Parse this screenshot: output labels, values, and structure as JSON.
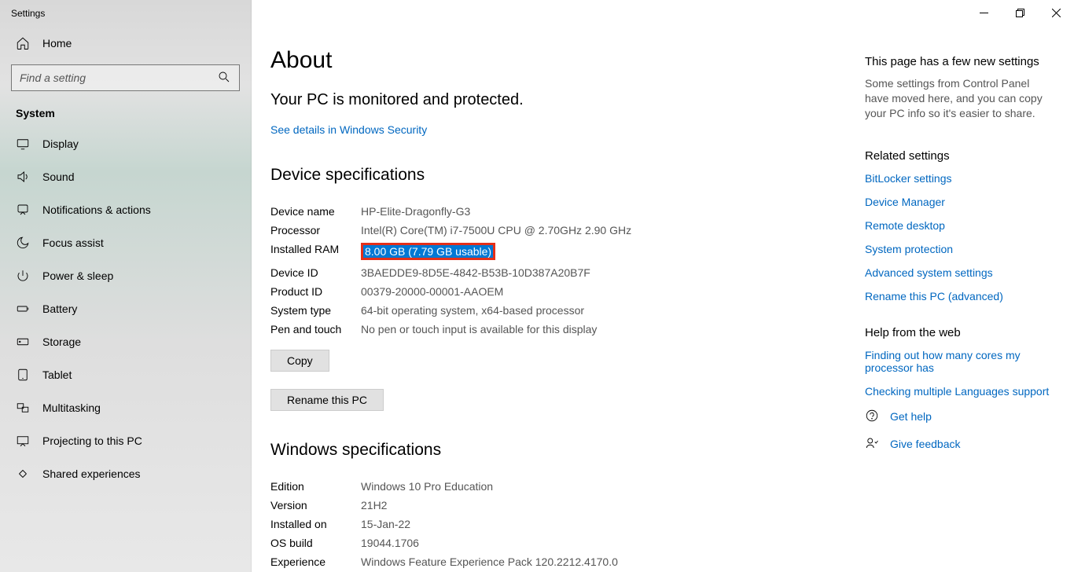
{
  "window": {
    "title": "Settings"
  },
  "sidebar": {
    "home": "Home",
    "search_placeholder": "Find a setting",
    "section": "System",
    "items": [
      {
        "label": "Display"
      },
      {
        "label": "Sound"
      },
      {
        "label": "Notifications & actions"
      },
      {
        "label": "Focus assist"
      },
      {
        "label": "Power & sleep"
      },
      {
        "label": "Battery"
      },
      {
        "label": "Storage"
      },
      {
        "label": "Tablet"
      },
      {
        "label": "Multitasking"
      },
      {
        "label": "Projecting to this PC"
      },
      {
        "label": "Shared experiences"
      }
    ]
  },
  "page": {
    "title": "About",
    "subtitle": "Your PC is monitored and protected.",
    "security_link": "See details in Windows Security",
    "device_spec_heading": "Device specifications",
    "device_specs": {
      "device_name": {
        "label": "Device name",
        "value": "HP-Elite-Dragonfly-G3"
      },
      "processor": {
        "label": "Processor",
        "value": "Intel(R) Core(TM) i7-7500U CPU @ 2.70GHz   2.90 GHz"
      },
      "ram": {
        "label": "Installed RAM",
        "value": "8.00 GB (7.79 GB usable)"
      },
      "device_id": {
        "label": "Device ID",
        "value": "3BAEDDE9-8D5E-4842-B53B-10D387A20B7F"
      },
      "product_id": {
        "label": "Product ID",
        "value": "00379-20000-00001-AAOEM"
      },
      "system_type": {
        "label": "System type",
        "value": "64-bit operating system, x64-based processor"
      },
      "pen_touch": {
        "label": "Pen and touch",
        "value": "No pen or touch input is available for this display"
      }
    },
    "copy_btn": "Copy",
    "rename_btn": "Rename this PC",
    "win_spec_heading": "Windows specifications",
    "win_specs": {
      "edition": {
        "label": "Edition",
        "value": "Windows 10 Pro Education"
      },
      "version": {
        "label": "Version",
        "value": "21H2"
      },
      "installed_on": {
        "label": "Installed on",
        "value": "15-Jan-22"
      },
      "os_build": {
        "label": "OS build",
        "value": "19044.1706"
      },
      "experience": {
        "label": "Experience",
        "value": "Windows Feature Experience Pack 120.2212.4170.0"
      }
    }
  },
  "right": {
    "new_heading": "This page has a few new settings",
    "new_text": "Some settings from Control Panel have moved here, and you can copy your PC info so it's easier to share.",
    "related_heading": "Related settings",
    "related": [
      "BitLocker settings",
      "Device Manager",
      "Remote desktop",
      "System protection",
      "Advanced system settings",
      "Rename this PC (advanced)"
    ],
    "help_heading": "Help from the web",
    "help_links": [
      "Finding out how many cores my processor has",
      "Checking multiple Languages support"
    ],
    "get_help": "Get help",
    "feedback": "Give feedback"
  }
}
